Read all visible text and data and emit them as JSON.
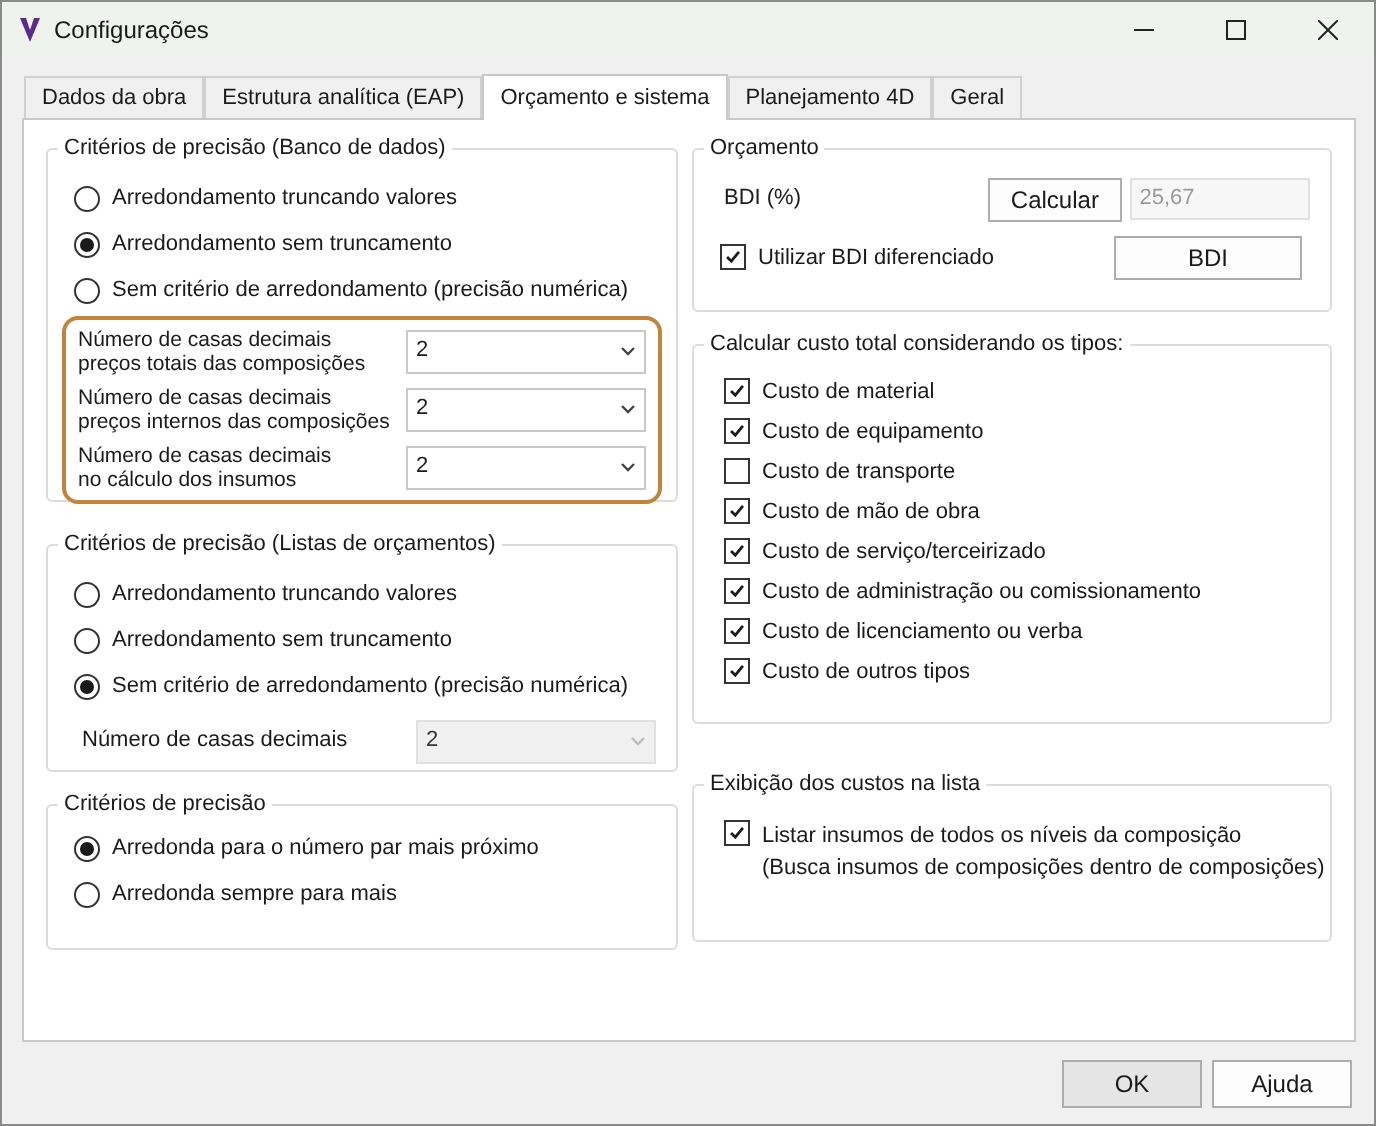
{
  "window": {
    "title": "Configurações"
  },
  "tabs": [
    {
      "label": "Dados da obra",
      "selected": false
    },
    {
      "label": "Estrutura analítica (EAP)",
      "selected": false
    },
    {
      "label": "Orçamento e sistema",
      "selected": true
    },
    {
      "label": "Planejamento 4D",
      "selected": false
    },
    {
      "label": "Geral",
      "selected": false
    }
  ],
  "database_precision": {
    "title": "Critérios de precisão (Banco de dados)",
    "options": [
      {
        "label": "Arredondamento truncando valores",
        "selected": false
      },
      {
        "label": "Arredondamento sem truncamento",
        "selected": true
      },
      {
        "label": "Sem critério de arredondamento (precisão numérica)",
        "selected": false
      }
    ],
    "decimal_fields": [
      {
        "label": "Número de casas decimais\npreços totais das composições",
        "value": "2",
        "disabled": false
      },
      {
        "label": "Número de casas decimais\npreços internos das composições",
        "value": "2",
        "disabled": false
      },
      {
        "label": "Número de casas decimais\nno cálculo dos insumos",
        "value": "2",
        "disabled": false
      }
    ]
  },
  "list_precision": {
    "title": "Critérios de precisão (Listas de orçamentos)",
    "options": [
      {
        "label": "Arredondamento truncando valores",
        "selected": false
      },
      {
        "label": "Arredondamento sem truncamento",
        "selected": false
      },
      {
        "label": "Sem critério de arredondamento (precisão numérica)",
        "selected": true
      }
    ],
    "decimal_field": {
      "label": "Número de casas decimais",
      "value": "2",
      "disabled": true
    }
  },
  "rounding": {
    "title": "Critérios de precisão",
    "options": [
      {
        "label": "Arredonda para o número par mais próximo",
        "selected": true
      },
      {
        "label": "Arredonda sempre para mais",
        "selected": false
      }
    ]
  },
  "budget": {
    "title": "Orçamento",
    "bdi_label": "BDI (%)",
    "calculate_button": "Calcular",
    "bdi_value": "25,67",
    "use_bdi": {
      "label": "Utilizar BDI diferenciado",
      "checked": true
    },
    "bdi_button": "BDI"
  },
  "cost_types": {
    "title": "Calcular custo total considerando os tipos:",
    "items": [
      {
        "label": "Custo de material",
        "checked": true
      },
      {
        "label": "Custo de equipamento",
        "checked": true
      },
      {
        "label": "Custo de transporte",
        "checked": false
      },
      {
        "label": "Custo de mão de obra",
        "checked": true
      },
      {
        "label": "Custo de serviço/terceirizado",
        "checked": true
      },
      {
        "label": "Custo de administração ou comissionamento",
        "checked": true
      },
      {
        "label": "Custo de licenciamento ou verba",
        "checked": true
      },
      {
        "label": "Custo de outros tipos",
        "checked": true
      }
    ]
  },
  "cost_display": {
    "title": "Exibição dos custos na lista",
    "items": [
      {
        "label": "Listar insumos de todos os níveis da composição\n(Busca insumos de composições dentro de composições)",
        "checked": true
      }
    ]
  },
  "buttons": [
    "OK",
    "Ajuda"
  ]
}
